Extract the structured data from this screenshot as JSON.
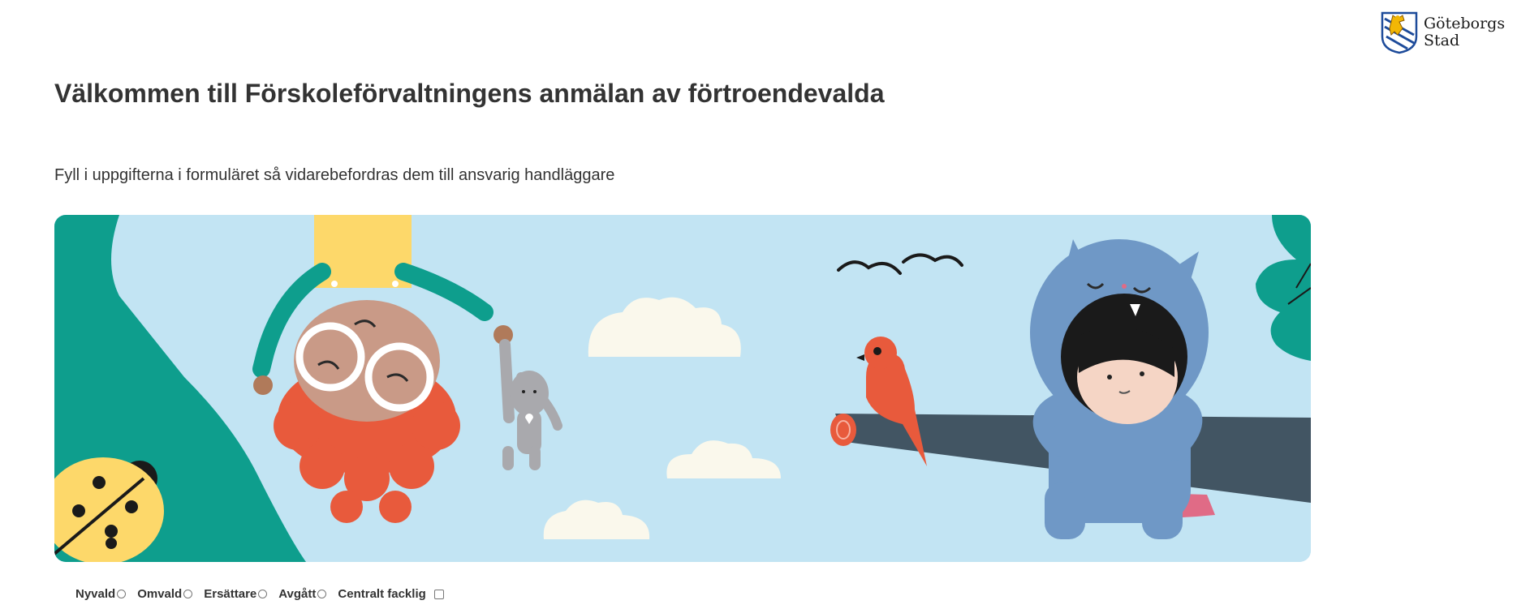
{
  "header": {
    "logo_line1": "Göteborgs",
    "logo_line2": "Stad"
  },
  "page": {
    "title": "Välkommen till Förskoleförvaltningens anmälan av förtroendevalda",
    "intro": "Fyll i uppgifterna i formuläret så vidarebefordras dem till ansvarig handläggare"
  },
  "hero_image": {
    "icon": "children-illustration"
  },
  "options": [
    {
      "label": "Nyvald",
      "type": "radio",
      "checked": false
    },
    {
      "label": "Omvald",
      "type": "radio",
      "checked": false
    },
    {
      "label": "Ersättare",
      "type": "radio",
      "checked": false
    },
    {
      "label": "Avgått",
      "type": "radio",
      "checked": false
    },
    {
      "label": "Centralt facklig",
      "type": "checkbox",
      "checked": false
    }
  ],
  "colors": {
    "text": "#333333",
    "sky": "#c2e4f3",
    "teal": "#0e9e8d",
    "orange": "#e85a3c",
    "slate": "#425563",
    "blue_costume": "#6f98c6",
    "yellow": "#fdd86a"
  }
}
